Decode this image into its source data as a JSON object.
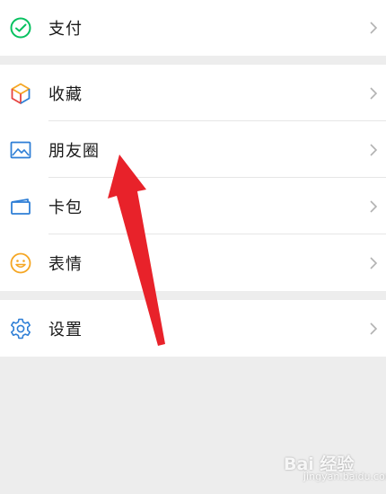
{
  "groups": [
    {
      "items": [
        {
          "label": "支付",
          "icon": "pay-icon",
          "color": "#07c160"
        }
      ]
    },
    {
      "items": [
        {
          "label": "收藏",
          "icon": "favorites-icon"
        },
        {
          "label": "朋友圈",
          "icon": "moments-icon",
          "color": "#2f7fd6"
        },
        {
          "label": "卡包",
          "icon": "cards-icon",
          "color": "#2f7fd6"
        },
        {
          "label": "表情",
          "icon": "sticker-icon",
          "color": "#f5a623"
        }
      ]
    },
    {
      "items": [
        {
          "label": "设置",
          "icon": "settings-icon",
          "color": "#2f7fd6"
        }
      ]
    }
  ],
  "annotation": {
    "type": "red-arrow",
    "color": "#e8222a"
  },
  "watermark": {
    "main": "Bai 经验",
    "sub": "jingyan.baidu.com"
  }
}
